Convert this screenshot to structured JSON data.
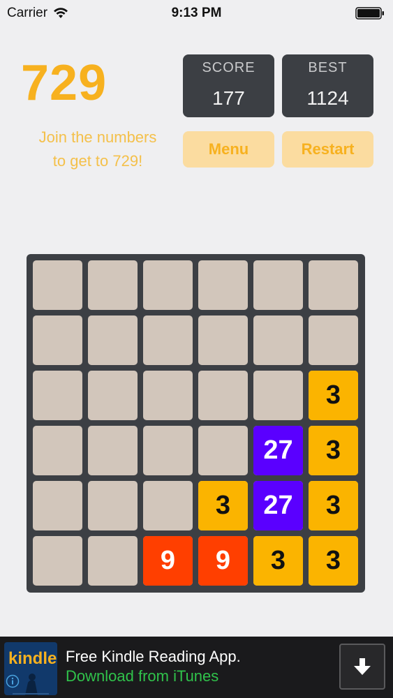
{
  "status_bar": {
    "carrier": "Carrier",
    "time": "9:13 PM"
  },
  "header": {
    "title": "729",
    "subtitle_line1": "Join the numbers",
    "subtitle_line2": "to get to 729!"
  },
  "score": {
    "label": "SCORE",
    "value": "177"
  },
  "best": {
    "label": "BEST",
    "value": "1124"
  },
  "buttons": {
    "menu": "Menu",
    "restart": "Restart"
  },
  "colors": {
    "accent": "#f7b11f",
    "tile_3": "#fbb400",
    "tile_9": "#ff3f00",
    "tile_27": "#5a00ff",
    "empty_cell": "#d2c6bb",
    "board": "#3c3f44"
  },
  "board": {
    "rows": [
      [
        "",
        "",
        "",
        "",
        "",
        ""
      ],
      [
        "",
        "",
        "",
        "",
        "",
        ""
      ],
      [
        "",
        "",
        "",
        "",
        "",
        "3"
      ],
      [
        "",
        "",
        "",
        "",
        "27",
        "3"
      ],
      [
        "",
        "",
        "",
        "3",
        "27",
        "3"
      ],
      [
        "",
        "",
        "9",
        "9",
        "3",
        "3"
      ]
    ]
  },
  "ad": {
    "logo_text": "kindle",
    "title": "Free Kindle Reading App.",
    "subtitle": "Download from iTunes",
    "download_icon": "download-arrow-icon",
    "info_icon": "info-icon"
  }
}
